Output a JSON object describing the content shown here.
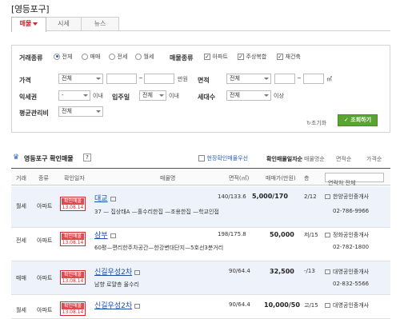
{
  "title": "[영등포구]",
  "tabs": [
    {
      "label": "매물"
    },
    {
      "label": "시세"
    },
    {
      "label": "뉴스"
    }
  ],
  "filter": {
    "deal_label": "거래종류",
    "deal_options": [
      "전체",
      "매매",
      "전세",
      "월세"
    ],
    "deal_selected": "전체",
    "type_label": "매물종류",
    "type_options": [
      "아파트",
      "주상복합",
      "재건축"
    ],
    "price_label": "가격",
    "price_select": "전체",
    "price_select2": "전체",
    "price_unit": "만원",
    "area_label": "면적",
    "area_select": "전체",
    "area_unit": "㎡",
    "premium_label": "익세권",
    "premium_select": "-",
    "premium_suffix": "이내",
    "move_label": "입주일",
    "move_select": "전체",
    "move_suffix": "이내",
    "household_label": "세대수",
    "household_select": "전체",
    "household_suffix": "이상",
    "maint_label": "평균관리비",
    "maint_select": "전체",
    "reset_label": "초기화",
    "search_label": "조회하기"
  },
  "section": {
    "title": "영등포구 확인매물",
    "help_icon": "?",
    "on_site_label": "현장확인매물우선",
    "sort_options": [
      "확인매물일자순",
      "매물명순",
      "면적순",
      "가격순"
    ]
  },
  "table_headers": [
    "거래",
    "종류",
    "확인일자",
    "매물명",
    "면적(㎡)",
    "매매가(만원)",
    "층",
    "연락처 전체"
  ],
  "rows": [
    {
      "deal": "월세",
      "type": "아파트",
      "stamp": "확인매물",
      "date": "13.08.14",
      "name": "대교",
      "desc": "37 — 집상태A —홀수리한집 —조용한집 —학교인접",
      "area": "140/133.6",
      "price": "5,000/170",
      "floor": "2/12",
      "agent": "한양공인중개사",
      "phone": "02-786-9966"
    },
    {
      "deal": "전세",
      "type": "아파트",
      "stamp": "확인매물",
      "date": "13.08.14",
      "name": "삼부",
      "desc": "60평—편리한주차공간—한강변대단지—5호선3분거리",
      "area": "198/175.8",
      "price": "50,000",
      "floor": "저/15",
      "agent": "정화공인중개사",
      "phone": "02-782-1800"
    },
    {
      "deal": "매매",
      "type": "아파트",
      "stamp": "확인매물",
      "date": "13.08.14",
      "name": "신길우성2차",
      "desc": "남향 로얄층 올수리",
      "area": "90/64.4",
      "price": "32,500",
      "floor": "-/13",
      "agent": "대영공인중개사",
      "phone": "02-832-5566"
    },
    {
      "deal": "월세",
      "type": "아파트",
      "stamp": "확인매물",
      "date": "13.08.14",
      "name": "신길우성2차",
      "desc": "",
      "area": "90/64.4",
      "price": "10,000/50",
      "floor": "고/15",
      "agent": "대영공인중개사",
      "phone": ""
    }
  ]
}
